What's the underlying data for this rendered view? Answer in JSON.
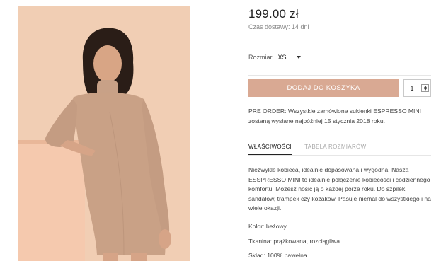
{
  "product": {
    "image_alt": "model in beige turtleneck dress",
    "price": "199.00 zł",
    "delivery": "Czas dostawy: 14 dni",
    "size": {
      "label": "Rozmiar",
      "selected": "XS"
    },
    "add_to_cart_label": "DODAJ DO KOSZYKA",
    "quantity": "1",
    "preorder_note": "PRE ORDER: Wszystkie zamówione sukienki ESPRESSO MINI zostaną wysłane najpóźniej 15 stycznia 2018 roku.",
    "tabs": [
      {
        "label": "WŁAŚCIWOŚCI"
      },
      {
        "label": "TABELA ROZMIARÓW"
      }
    ],
    "description": "Niezwykle kobieca, idealnie dopasowana i wygodna! Nasza ESSPRESSO MINI to idealnie połączenie kobiecości i codziennego komfortu. Możesz nosić ją o każdej porze roku. Do szpilek, sandałów, trampek czy kozaków. Pasuje niemal do wszystkiego i na wiele okazji.",
    "attributes": [
      {
        "text": "Kolor: beżowy"
      },
      {
        "text": "Tkanina: prążkowana, rozciągliwa"
      },
      {
        "text": "Skład: 100% bawełna"
      }
    ]
  },
  "colors": {
    "accent": "#d9a993",
    "background_image": "#f1cdb6"
  }
}
